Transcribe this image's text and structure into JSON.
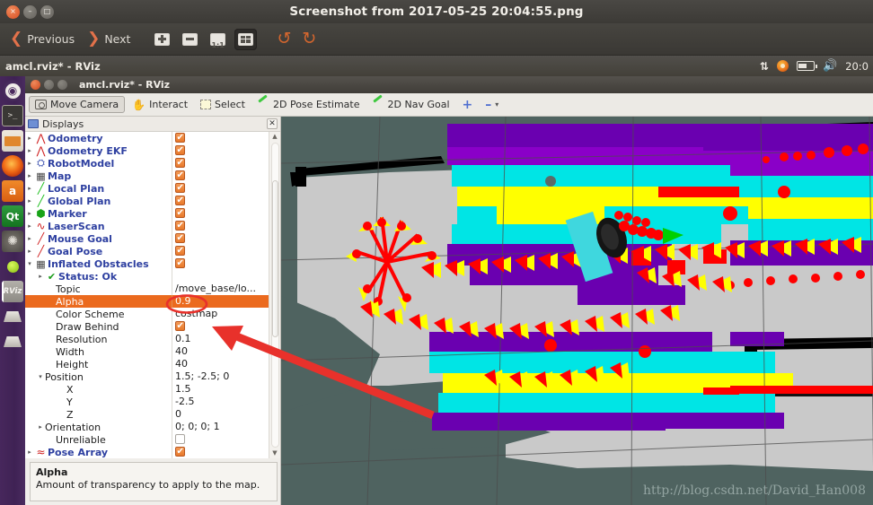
{
  "eog_window": {
    "title": "Screenshot from 2017-05-25 20:04:55.png",
    "window_buttons": {
      "close": "×",
      "minimize": "–",
      "maximize": "□"
    },
    "toolbar": {
      "previous_label": "Previous",
      "next_label": "Next",
      "prev_icon": "chevron-left-icon",
      "next_icon": "chevron-right-icon",
      "zoom_in_icon": "zoom-in-icon",
      "zoom_out_icon": "zoom-out-icon",
      "normal_size_icon": "zoom-100-icon",
      "best_fit_icon": "zoom-best-fit-icon",
      "rotate_left_icon": "rotate-left-icon",
      "rotate_right_icon": "rotate-right-icon",
      "zoom_100_glyph": "1:1"
    }
  },
  "unity_panel": {
    "app_title": "amcl.rviz* - RViz",
    "clock": "20:0",
    "network_icon": "network-up-down-icon",
    "updates_icon": "software-updates-icon",
    "battery_icon": "battery-icon",
    "volume_icon": "volume-icon"
  },
  "launcher": {
    "items": [
      {
        "name": "ubuntu-dash",
        "glyph": "◉"
      },
      {
        "name": "terminal",
        "glyph": ">_"
      },
      {
        "name": "files",
        "glyph": ""
      },
      {
        "name": "firefox",
        "glyph": ""
      },
      {
        "name": "amazon",
        "glyph": "a"
      },
      {
        "name": "qt-creator",
        "glyph": "Qt"
      },
      {
        "name": "system-settings",
        "glyph": "✺"
      },
      {
        "name": "indicator-green",
        "glyph": ""
      },
      {
        "name": "rviz",
        "glyph": "RViz"
      },
      {
        "name": "window-1",
        "glyph": ""
      },
      {
        "name": "window-2",
        "glyph": ""
      }
    ]
  },
  "rviz": {
    "title": "amcl.rviz* - RViz",
    "toolbar": {
      "move_camera": "Move Camera",
      "interact": "Interact",
      "select": "Select",
      "pose_estimate": "2D Pose Estimate",
      "nav_goal": "2D Nav Goal",
      "add_label": "+",
      "remove_label": "–",
      "caret_label": "▾"
    },
    "displays_panel": {
      "title": "Displays",
      "close_label": "✕",
      "panel_icon": "monitor-icon",
      "tree": [
        {
          "kind": "display",
          "indent": 0,
          "arrow": "▸",
          "icon": "odometry-icon",
          "label": "Odometry",
          "value": "",
          "checkbox": "on"
        },
        {
          "kind": "display",
          "indent": 0,
          "arrow": "▸",
          "icon": "odometry-icon",
          "label": "Odometry EKF",
          "value": "",
          "checkbox": "on"
        },
        {
          "kind": "display",
          "indent": 0,
          "arrow": "▸",
          "icon": "robotmodel-icon",
          "label": "RobotModel",
          "value": "",
          "checkbox": "on"
        },
        {
          "kind": "display",
          "indent": 0,
          "arrow": "▸",
          "icon": "map-icon",
          "label": "Map",
          "value": "",
          "checkbox": "on"
        },
        {
          "kind": "display",
          "indent": 0,
          "arrow": "▸",
          "icon": "path-icon",
          "label": "Local Plan",
          "value": "",
          "checkbox": "on"
        },
        {
          "kind": "display",
          "indent": 0,
          "arrow": "▸",
          "icon": "path-icon",
          "label": "Global Plan",
          "value": "",
          "checkbox": "on"
        },
        {
          "kind": "display",
          "indent": 0,
          "arrow": "▸",
          "icon": "marker-icon",
          "label": "Marker",
          "value": "",
          "checkbox": "on"
        },
        {
          "kind": "display",
          "indent": 0,
          "arrow": "▸",
          "icon": "laserscan-icon",
          "label": "LaserScan",
          "value": "",
          "checkbox": "on"
        },
        {
          "kind": "display",
          "indent": 0,
          "arrow": "▸",
          "icon": "pose-icon",
          "label": "Mouse Goal",
          "value": "",
          "checkbox": "on"
        },
        {
          "kind": "display",
          "indent": 0,
          "arrow": "▸",
          "icon": "pose-icon",
          "label": "Goal Pose",
          "value": "",
          "checkbox": "on"
        },
        {
          "kind": "display",
          "indent": 0,
          "arrow": "▾",
          "icon": "map-icon",
          "label": "Inflated Obstacles",
          "value": "",
          "checkbox": "on"
        },
        {
          "kind": "status",
          "indent": 1,
          "arrow": "▸",
          "icon": "check-icon",
          "label": "Status: Ok",
          "value": "",
          "checkbox": ""
        },
        {
          "kind": "prop",
          "indent": 2,
          "arrow": "",
          "icon": "",
          "label": "Topic",
          "value": "/move_base/lo...",
          "checkbox": ""
        },
        {
          "kind": "prop",
          "indent": 2,
          "arrow": "",
          "icon": "",
          "label": "Alpha",
          "value": "0.9",
          "checkbox": "",
          "selected": true
        },
        {
          "kind": "prop",
          "indent": 2,
          "arrow": "",
          "icon": "",
          "label": "Color Scheme",
          "value": "costmap",
          "checkbox": ""
        },
        {
          "kind": "prop",
          "indent": 2,
          "arrow": "",
          "icon": "",
          "label": "Draw Behind",
          "value": "",
          "checkbox": "on"
        },
        {
          "kind": "prop",
          "indent": 2,
          "arrow": "",
          "icon": "",
          "label": "Resolution",
          "value": "0.1",
          "checkbox": ""
        },
        {
          "kind": "prop",
          "indent": 2,
          "arrow": "",
          "icon": "",
          "label": "Width",
          "value": "40",
          "checkbox": ""
        },
        {
          "kind": "prop",
          "indent": 2,
          "arrow": "",
          "icon": "",
          "label": "Height",
          "value": "40",
          "checkbox": ""
        },
        {
          "kind": "prop",
          "indent": 1,
          "arrow": "▾",
          "icon": "",
          "label": "Position",
          "value": "1.5; -2.5; 0",
          "checkbox": ""
        },
        {
          "kind": "prop",
          "indent": 3,
          "arrow": "",
          "icon": "",
          "label": "X",
          "value": "1.5",
          "checkbox": ""
        },
        {
          "kind": "prop",
          "indent": 3,
          "arrow": "",
          "icon": "",
          "label": "Y",
          "value": "-2.5",
          "checkbox": ""
        },
        {
          "kind": "prop",
          "indent": 3,
          "arrow": "",
          "icon": "",
          "label": "Z",
          "value": "0",
          "checkbox": ""
        },
        {
          "kind": "prop",
          "indent": 1,
          "arrow": "▸",
          "icon": "",
          "label": "Orientation",
          "value": "0; 0; 0; 1",
          "checkbox": ""
        },
        {
          "kind": "prop",
          "indent": 2,
          "arrow": "",
          "icon": "",
          "label": "Unreliable",
          "value": "",
          "checkbox": "off"
        },
        {
          "kind": "display",
          "indent": 0,
          "arrow": "▸",
          "icon": "posearray-icon",
          "label": "Pose Array",
          "value": "",
          "checkbox": "on"
        }
      ],
      "description": {
        "title": "Alpha",
        "text": "Amount of transparency to apply to the map."
      }
    },
    "view3d": {
      "watermark": "http://blog.csdn.net/David_Han008",
      "background_color": "#4f6360",
      "free_space_color": "#c9c9c9",
      "wall_color": "#000000",
      "costmap_colors": [
        "#6a00b0",
        "#00e5e5",
        "#ffff00",
        "#ff0000"
      ],
      "pose_arrow_colors": [
        "#ff0000",
        "#ffff00"
      ],
      "robot_body_color": "#3fd7de",
      "heading_arrow_color": "#00d000"
    }
  },
  "annotation": {
    "highlight_color": "#e8312b",
    "ellipse_target": "0.9",
    "arrow_label": "alpha-callout-arrow"
  }
}
